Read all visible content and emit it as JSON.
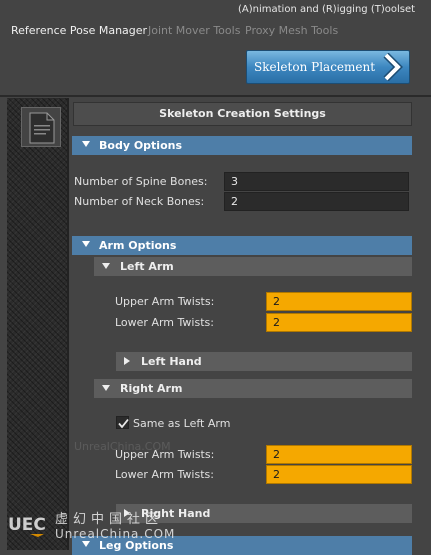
{
  "window": {
    "title": "(A)nimation and (R)igging (T)oolset"
  },
  "tabs": [
    {
      "label": "Reference Pose Manager",
      "active": true
    },
    {
      "label": "Joint Mover Tools",
      "active": false
    },
    {
      "label": "Proxy Mesh Tools",
      "active": false
    }
  ],
  "skeleton_button": {
    "label": "Skeleton Placement",
    "icon": "chevron-right-icon"
  },
  "sidebar": {
    "icon": "document-icon"
  },
  "settings": {
    "title": "Skeleton Creation Settings"
  },
  "body_options": {
    "header": "Body Options",
    "spine_label": "Number of Spine Bones:",
    "spine_value": "3",
    "neck_label": "Number of Neck Bones:",
    "neck_value": "2"
  },
  "arm_options": {
    "header": "Arm Options",
    "left_arm": {
      "header": "Left Arm",
      "upper_label": "Upper Arm Twists:",
      "upper_value": "2",
      "lower_label": "Lower Arm Twists:",
      "lower_value": "2",
      "hand_header": "Left Hand"
    },
    "right_arm": {
      "header": "Right Arm",
      "same_label": "Same as Left Arm",
      "same_checked": true,
      "upper_label": "Upper Arm Twists:",
      "upper_value": "2",
      "lower_label": "Lower Arm Twists:",
      "lower_value": "2",
      "hand_header": "Right Hand"
    }
  },
  "leg_options": {
    "header": "Leg Options"
  },
  "watermark": {
    "faint": "UnrealChina.COM",
    "logo": "UECN",
    "cn": "虚幻中国社区",
    "en": "UnrealChina.COM"
  },
  "colors": {
    "section_header": "#4e7ea8",
    "field_highlight": "#f5a800",
    "button_blue": "#3d87c0"
  }
}
